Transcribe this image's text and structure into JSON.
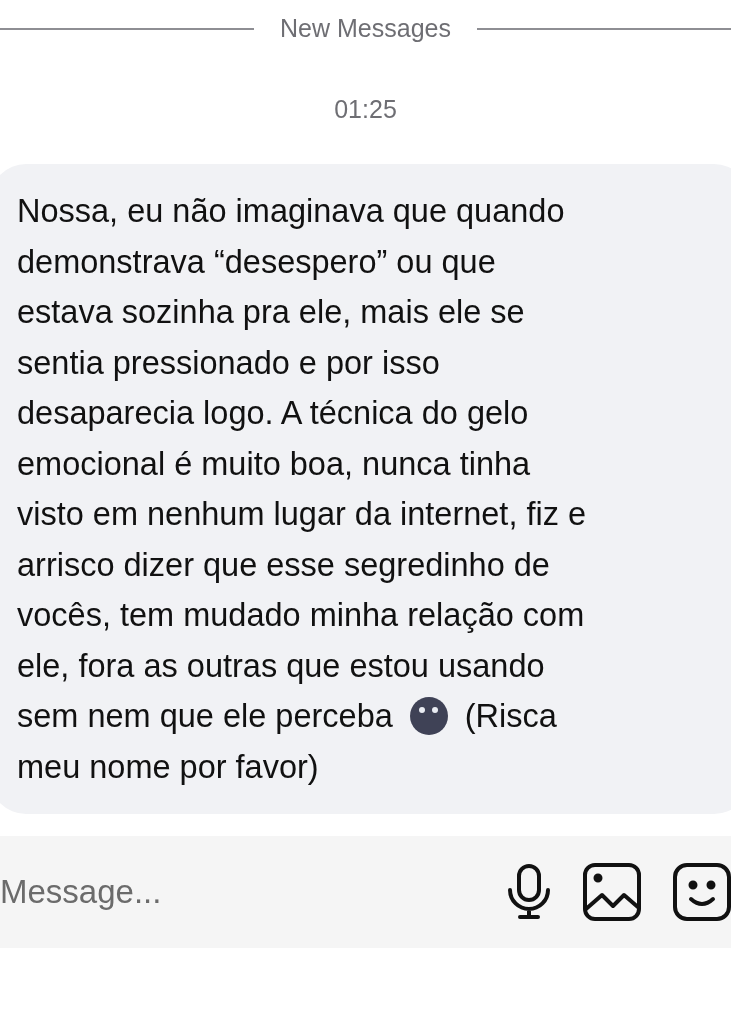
{
  "divider": {
    "label": "New Messages"
  },
  "timestamp": "01:25",
  "message": {
    "lines": [
      {
        "text": "Nossa, eu não imaginava que quando"
      },
      {
        "text": "demonstrava “desespero” ou que"
      },
      {
        "text": "estava sozinha pra ele, mais ele se"
      },
      {
        "text": "sentia pressionado e por isso"
      },
      {
        "text": "desaparecia logo. A técnica do gelo"
      },
      {
        "text": "emocional é muito boa, nunca tinha"
      },
      {
        "text": "visto em nenhum lugar da internet, fiz e"
      },
      {
        "text": "arrisco dizer que esse segredinho de"
      },
      {
        "text": "vocês, tem mudado minha relação com"
      },
      {
        "text": "ele, fora as outras que estou usando"
      },
      {
        "kind": "emoji",
        "text": "sem nem que ele perceba",
        "text_after": "(Risca"
      },
      {
        "text": "meu nome por favor)"
      }
    ]
  },
  "composer": {
    "placeholder": "Message..."
  }
}
